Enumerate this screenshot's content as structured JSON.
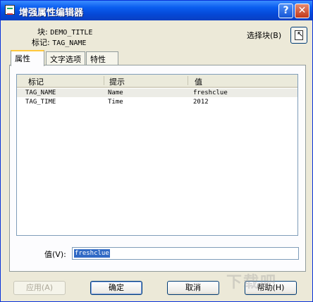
{
  "window": {
    "title": "增强属性编辑器"
  },
  "info": {
    "block_label": "块:",
    "block_value": "DEMO_TITLE",
    "tag_label": "标记:",
    "tag_value": "TAG_NAME",
    "select_block_label": "选择块(B)"
  },
  "tabs": [
    {
      "label": "属性",
      "active": true
    },
    {
      "label": "文字选项",
      "active": false
    },
    {
      "label": "特性",
      "active": false
    }
  ],
  "grid": {
    "columns": [
      "标记",
      "提示",
      "值"
    ],
    "rows": [
      {
        "tag": "TAG_NAME",
        "prompt": "Name",
        "value": "freshclue",
        "selected": true
      },
      {
        "tag": "TAG_TIME",
        "prompt": "Time",
        "value": "2012",
        "selected": false
      }
    ]
  },
  "value_field": {
    "label": "值(V):",
    "value": "freshclue"
  },
  "buttons": {
    "apply": "应用(A)",
    "ok": "确定",
    "cancel": "取消",
    "help": "帮助(H)"
  },
  "watermark": "下载吧",
  "icons": {
    "select_block": "select-object-icon",
    "app": "attribute-editor-icon"
  },
  "colors": {
    "titlebar": "#0A5DEF",
    "dialog_bg": "#ECE9D8",
    "selection": "#316AC5"
  }
}
